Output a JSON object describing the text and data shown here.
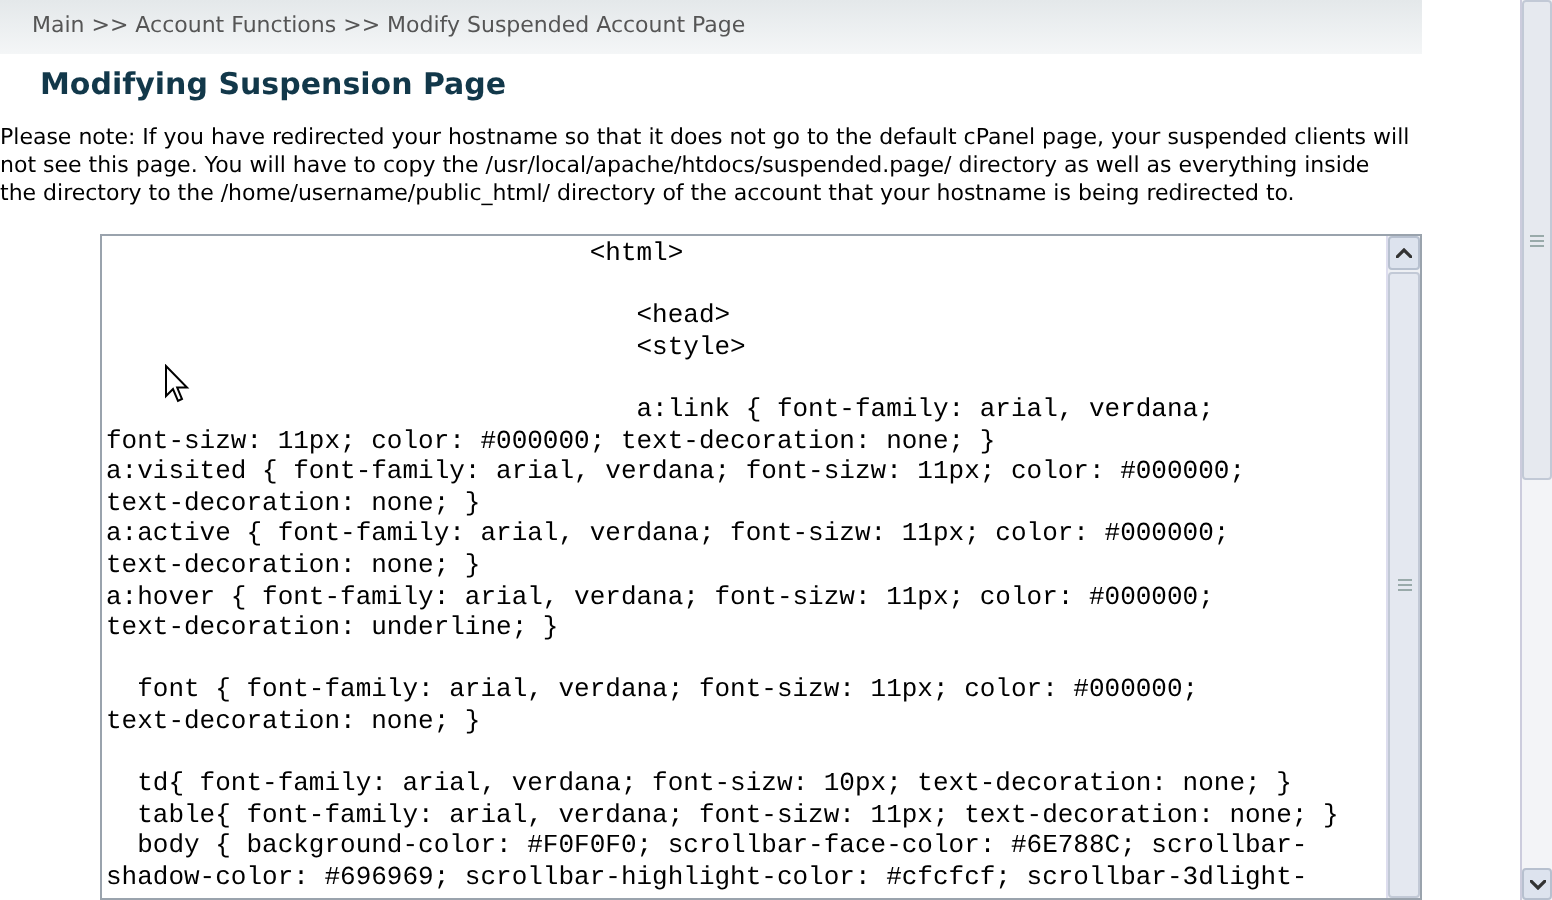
{
  "breadcrumb": "Main >> Account Functions >> Modify Suspended Account Page",
  "heading": "Modifying Suspension Page",
  "note": "Please note: If you have redirected your hostname so that it does not go to the default cPanel page, your suspended clients will not see this page. You will have to copy the /usr/local/apache/htdocs/suspended.page/ directory as well as everything inside the directory to the /home/username/public_html/ directory of the account that your hostname is being redirected to.",
  "editor": {
    "blocks": [
      [
        "                               <html>"
      ],
      [
        "                                  <head>",
        "                                  <style>"
      ],
      [
        "                                  a:link { font-family: arial, verdana;",
        "font-sizw: 11px; color: #000000; text-decoration: none; }",
        "a:visited { font-family: arial, verdana; font-sizw: 11px; color: #000000;",
        "text-decoration: none; }",
        "a:active { font-family: arial, verdana; font-sizw: 11px; color: #000000;",
        "text-decoration: none; }",
        "a:hover { font-family: arial, verdana; font-sizw: 11px; color: #000000;",
        "text-decoration: underline; }"
      ],
      [
        "  font { font-family: arial, verdana; font-sizw: 11px; color: #000000;",
        "text-decoration: none; }"
      ],
      [
        "  td{ font-family: arial, verdana; font-sizw: 10px; text-decoration: none; }",
        "  table{ font-family: arial, verdana; font-sizw: 11px; text-decoration: none; }",
        "  body { background-color: #F0F0F0; scrollbar-face-color: #6E788C; scrollbar-",
        "shadow-color: #696969; scrollbar-highlight-color: #cfcfcf; scrollbar-3dlight-"
      ]
    ]
  }
}
